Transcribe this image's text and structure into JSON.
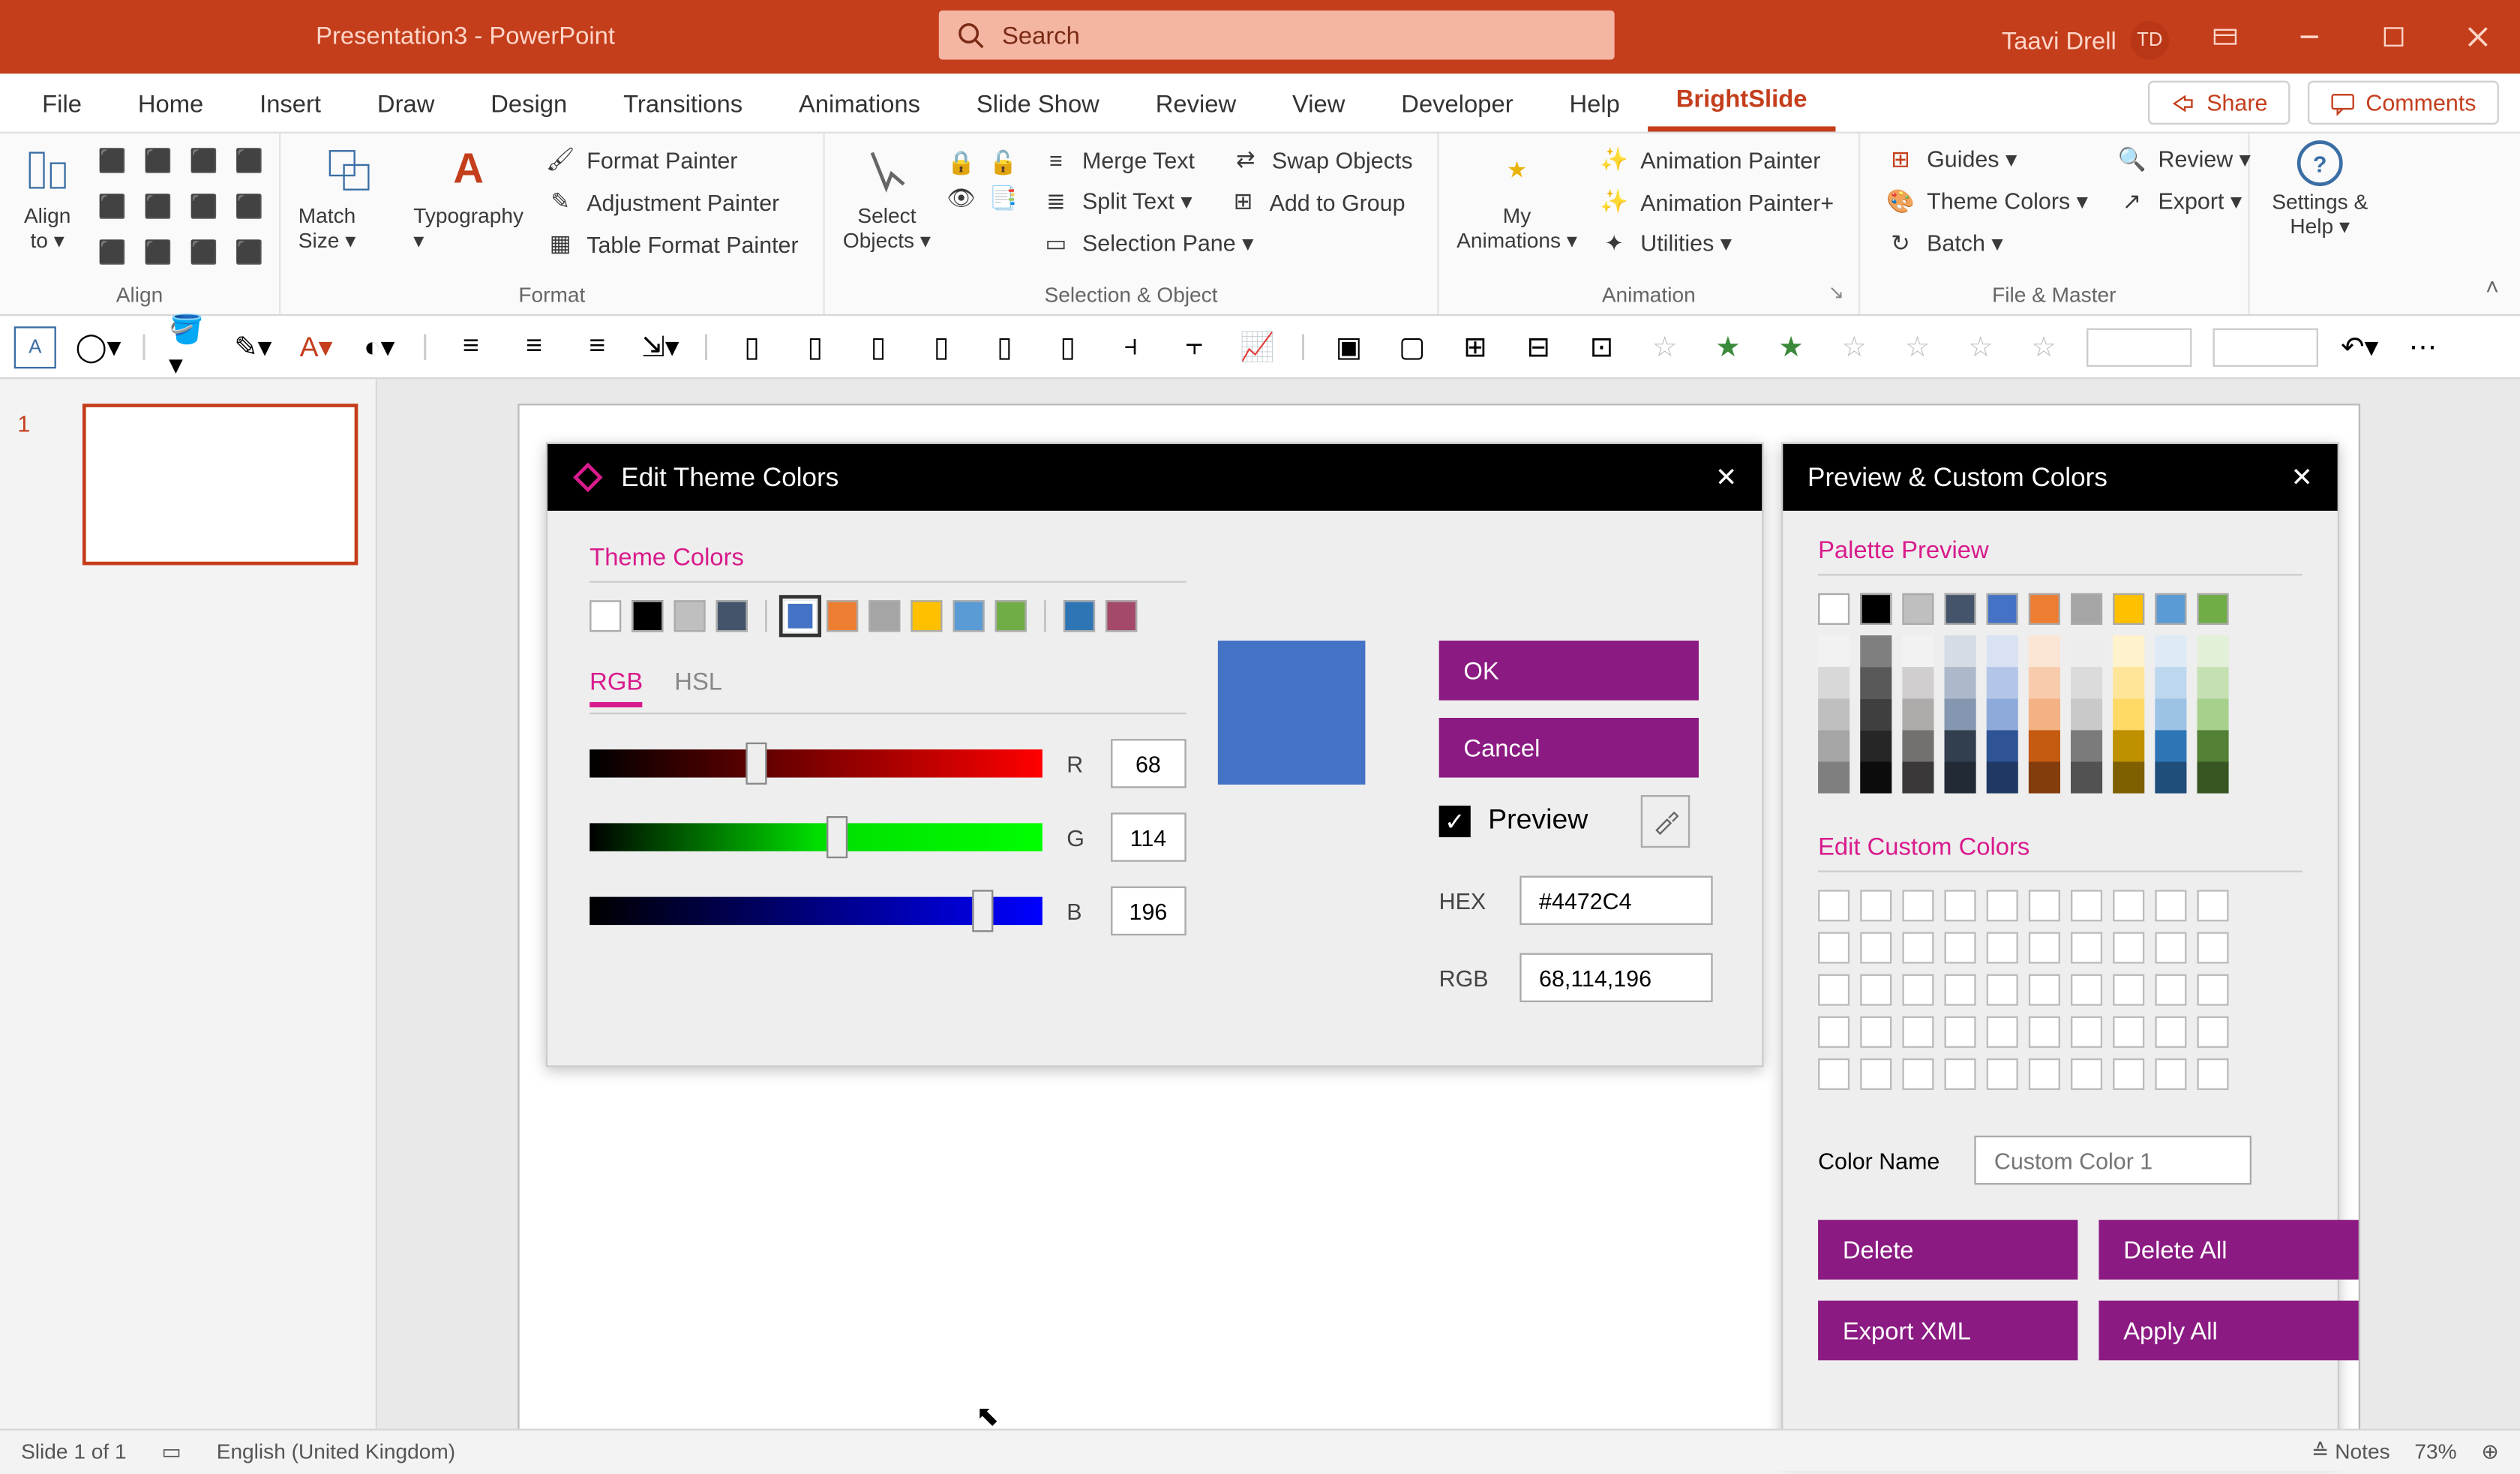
{
  "app": {
    "title": "Presentation3  -  PowerPoint"
  },
  "search": {
    "placeholder": "Search"
  },
  "user": {
    "name": "Taavi Drell",
    "initials": "TD"
  },
  "tabs": {
    "file": "File",
    "home": "Home",
    "insert": "Insert",
    "draw": "Draw",
    "design": "Design",
    "transitions": "Transitions",
    "animations": "Animations",
    "slideshow": "Slide Show",
    "review": "Review",
    "view": "View",
    "developer": "Developer",
    "help": "Help",
    "brightslide": "BrightSlide",
    "share": "Share",
    "comments": "Comments"
  },
  "ribbon": {
    "align": {
      "label": "Align",
      "alignto": "Align to ▾",
      "matchsize": "Match Size ▾",
      "typography": "Typography ▾"
    },
    "format": {
      "label": "Format",
      "formatpainter": "Format Painter",
      "adjpainter": "Adjustment Painter",
      "tablefmtpainter": "Table Format Painter"
    },
    "selobj": {
      "label": "Selection & Object",
      "selectobjects": "Select Objects ▾",
      "mergetext": "Merge Text",
      "swapobj": "Swap Objects",
      "splittext": "Split Text ▾",
      "addtogroup": "Add to Group",
      "selectionpane": "Selection Pane ▾"
    },
    "animation": {
      "label": "Animation",
      "myanim": "My Animations ▾",
      "animpainter": "Animation Painter",
      "animpainterplus": "Animation Painter+",
      "utilities": "Utilities ▾"
    },
    "filemaster": {
      "label": "File & Master",
      "guides": "Guides ▾",
      "themecolors": "Theme Colors ▾",
      "batch": "Batch ▾",
      "review": "Review ▾",
      "export": "Export ▾"
    },
    "settings": {
      "label": "",
      "settingshelp": "Settings & Help ▾"
    }
  },
  "slidepanel": {
    "num": "1"
  },
  "dialog1": {
    "title": "Edit Theme Colors",
    "themecolors": "Theme Colors",
    "ok": "OK",
    "cancel": "Cancel",
    "preview": "Preview",
    "rgb": "RGB",
    "hsl": "HSL",
    "r": "R",
    "g": "G",
    "b": "B",
    "rval": "68",
    "gval": "114",
    "bval": "196",
    "hexlabel": "HEX",
    "hexval": "#4472C4",
    "rgblabel": "RGB",
    "rgbval": "68,114,196",
    "swatches": [
      "#ffffff",
      "#000000",
      "#bfbfbf",
      "#44546a",
      "",
      "#4472c4",
      "#ed7d31",
      "#a5a5a5",
      "#ffc000",
      "#5b9bd5",
      "#70ad47",
      "",
      "#2e75b6",
      "#a5496a"
    ]
  },
  "dialog2": {
    "title": "Preview & Custom Colors",
    "palettepreview": "Palette Preview",
    "editcustom": "Edit Custom Colors",
    "colorname": "Color Name",
    "colorname_ph": "Custom Color 1",
    "delete": "Delete",
    "deleteall": "Delete All",
    "exportxml": "Export XML",
    "applyall": "Apply All"
  },
  "status": {
    "slide": "Slide 1 of 1",
    "lang": "English (United Kingdom)",
    "notes": "Notes",
    "zoom": "73%"
  },
  "palette_base": [
    "#ffffff",
    "#000000",
    "#bfbfbf",
    "#44546a",
    "#4472c4",
    "#ed7d31",
    "#a5a5a5",
    "#ffc000",
    "#5b9bd5",
    "#70ad47"
  ],
  "palette_shades": [
    [
      "#f2f2f2",
      "#7f7f7f",
      "#f2f2f2",
      "#d6dce4",
      "#d9e2f3",
      "#fbe5d5",
      "#ededed",
      "#fff2cc",
      "#deebf6",
      "#e2efd9"
    ],
    [
      "#d8d8d8",
      "#595959",
      "#d0cece",
      "#adb9ca",
      "#b4c6e7",
      "#f7cbac",
      "#dbdbdb",
      "#fee599",
      "#bdd7ee",
      "#c5e0b3"
    ],
    [
      "#bfbfbf",
      "#3f3f3f",
      "#aeabab",
      "#8496b0",
      "#8eaadb",
      "#f4b183",
      "#c9c9c9",
      "#ffd965",
      "#9cc3e5",
      "#a8d08d"
    ],
    [
      "#a5a5a5",
      "#262626",
      "#757070",
      "#323f4f",
      "#2f5496",
      "#c55a11",
      "#7b7b7b",
      "#bf9000",
      "#2e75b5",
      "#538135"
    ],
    [
      "#7f7f7f",
      "#0c0c0c",
      "#3a3838",
      "#222a35",
      "#1f3864",
      "#833c0b",
      "#525252",
      "#7f6000",
      "#1e4e79",
      "#375623"
    ]
  ]
}
